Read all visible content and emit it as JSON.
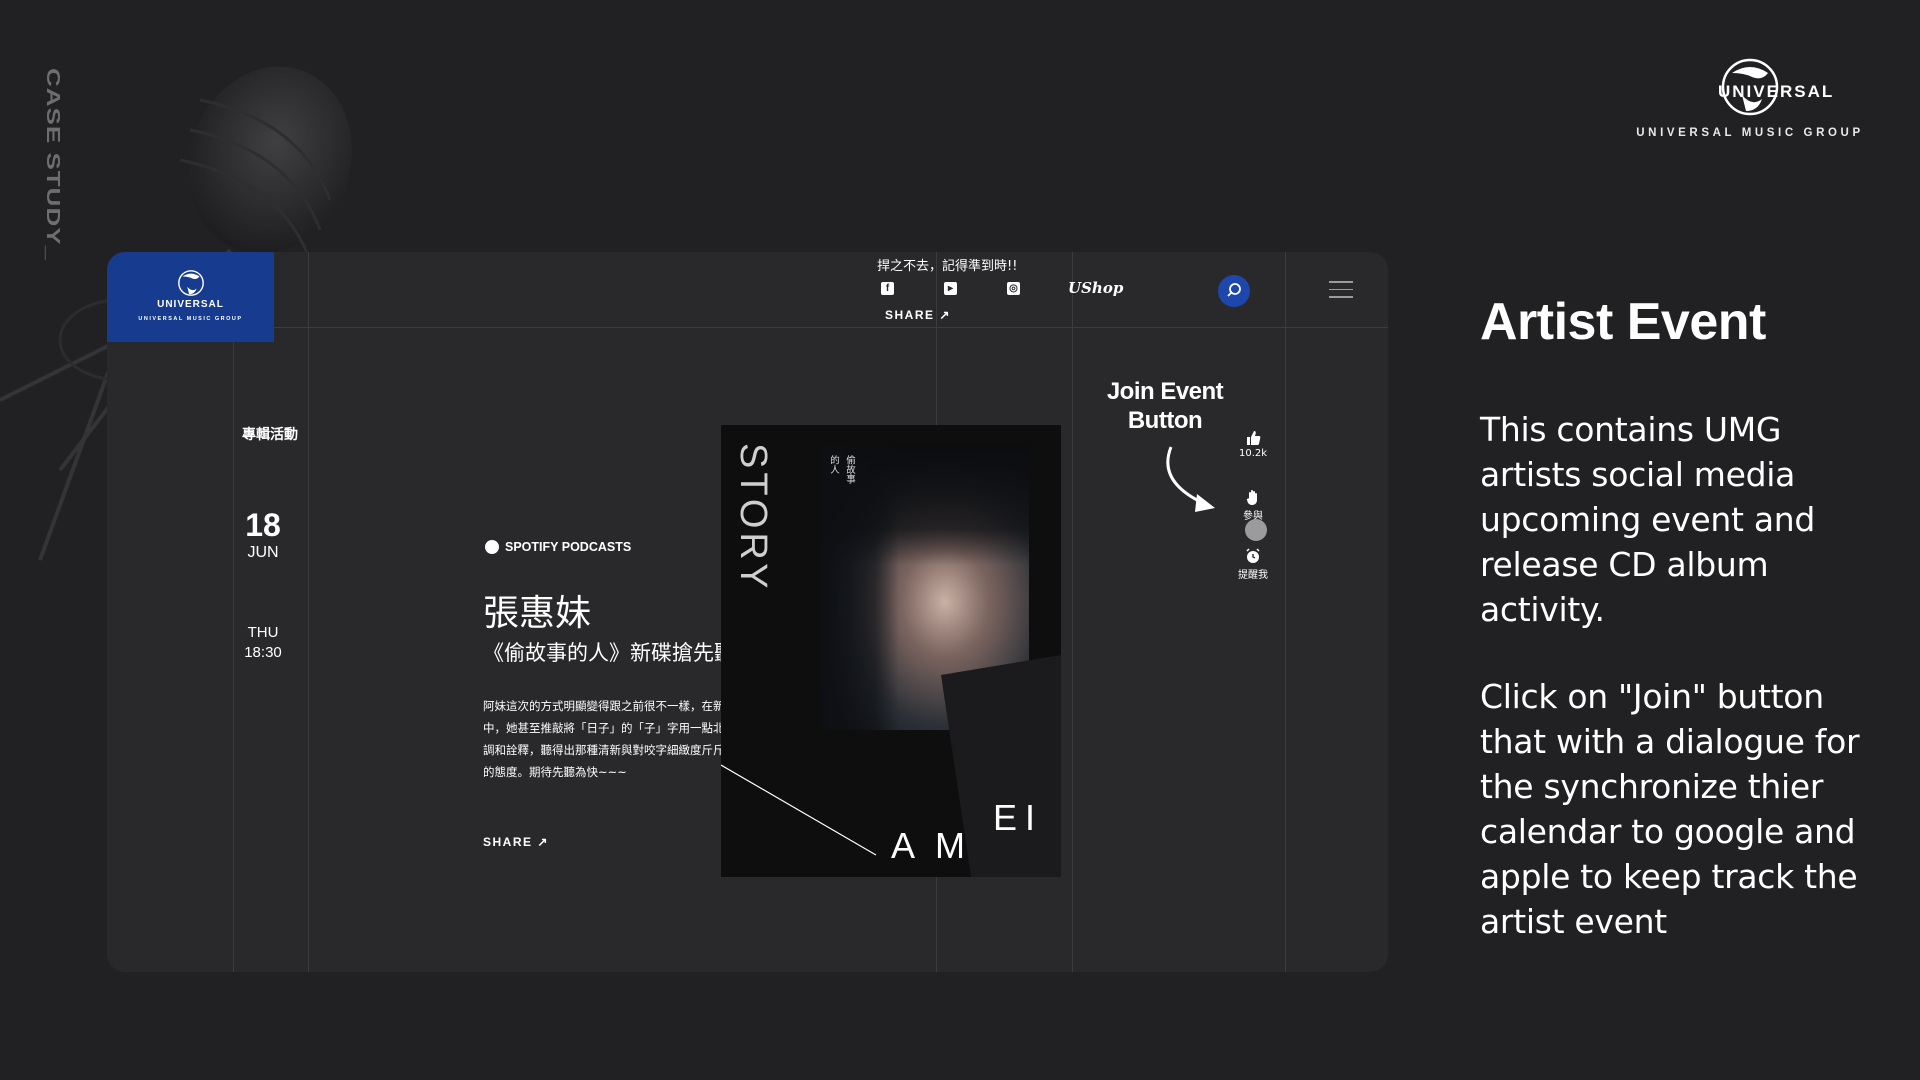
{
  "side_label": "CASE STUDY_",
  "brand": {
    "wordmark": "UNIVERSAL",
    "group": "UNIVERSAL MUSIC GROUP"
  },
  "mockup": {
    "logo": {
      "wordmark": "UNIVERSAL",
      "group": "UNIVERSAL MUSIC GROUP"
    },
    "header": {
      "slogan": "捍之不去，記得準到時!!",
      "social_icons": [
        "facebook-icon",
        "youtube-icon",
        "instagram-icon"
      ],
      "shop_label": "UShop",
      "share_label": "SHARE ↗"
    },
    "sidebar": {
      "category": "專輯活動",
      "day": "18",
      "month": "JUN",
      "weekday": "THU",
      "time": "18:30"
    },
    "article": {
      "source": "SPOTIFY PODCASTS",
      "artist": "張惠妹",
      "subtitle": "《偷故事的人》新碟搶先聽",
      "description": "阿妹這次的方式明顯變得跟之前很不一樣，在新碟中，她甚至推敲將「日子」的「子」字用一點北京腔調和詮釋，聽得出那種清新與對咬字細緻度斤斤計較的態度。期待先聽為快~~~",
      "share_label": "SHARE ↗"
    },
    "cover": {
      "story": "STORY",
      "cover_text_1": "的人",
      "cover_text_2": "偷故事",
      "amei_a": "A M",
      "amei_ei": "EI"
    },
    "annotation": "Join Event Button",
    "actions": {
      "like_count": "10.2k",
      "join_label": "參與",
      "remind_label": "提醒我"
    }
  },
  "right_panel": {
    "title": "Artist Event",
    "para1": "This contains UMG artists social media upcoming event and release CD album activity.",
    "para2": "Click on \"Join\" button that with a dialogue for the synchronize thier calendar to google and apple to keep track the artist event"
  }
}
